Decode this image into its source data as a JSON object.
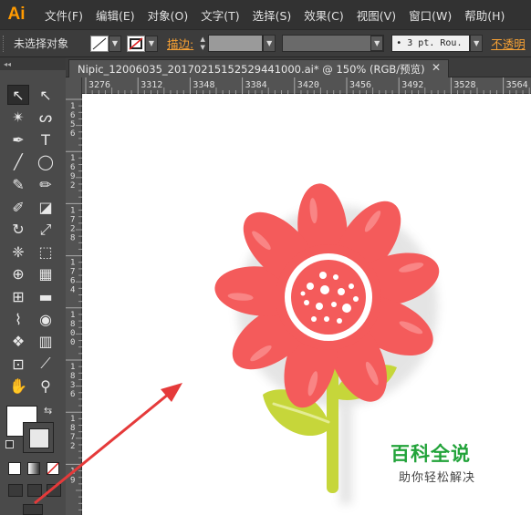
{
  "app": {
    "logo_text": "Ai"
  },
  "menu": {
    "items": [
      "文件(F)",
      "编辑(E)",
      "对象(O)",
      "文字(T)",
      "选择(S)",
      "效果(C)",
      "视图(V)",
      "窗口(W)",
      "帮助(H)"
    ]
  },
  "control_bar": {
    "selection_status": "未选择对象",
    "stroke_label": "描边:",
    "brush_value": "• 3 pt. Rou.",
    "opacity_label": "不透明"
  },
  "tools_panel": {
    "header_glyph": "◂◂",
    "tools": [
      {
        "name": "selection-tool",
        "glyph": "↖"
      },
      {
        "name": "direct-selection-tool",
        "glyph": "↖"
      },
      {
        "name": "magic-wand-tool",
        "glyph": "✴"
      },
      {
        "name": "lasso-tool",
        "glyph": "ᔕ"
      },
      {
        "name": "pen-tool",
        "glyph": "✒"
      },
      {
        "name": "type-tool",
        "glyph": "T"
      },
      {
        "name": "line-tool",
        "glyph": "╱"
      },
      {
        "name": "ellipse-tool",
        "glyph": "◯"
      },
      {
        "name": "paintbrush-tool",
        "glyph": "✎"
      },
      {
        "name": "pencil-tool",
        "glyph": "✏"
      },
      {
        "name": "blob-brush-tool",
        "glyph": "✐"
      },
      {
        "name": "eraser-tool",
        "glyph": "◪"
      },
      {
        "name": "rotate-tool",
        "glyph": "↻"
      },
      {
        "name": "scale-tool",
        "glyph": "⤢"
      },
      {
        "name": "warp-tool",
        "glyph": "❈"
      },
      {
        "name": "free-transform-tool",
        "glyph": "⬚"
      },
      {
        "name": "shape-builder-tool",
        "glyph": "⊕"
      },
      {
        "name": "perspective-grid-tool",
        "glyph": "▦"
      },
      {
        "name": "mesh-tool",
        "glyph": "⊞"
      },
      {
        "name": "gradient-tool",
        "glyph": "▬"
      },
      {
        "name": "eyedropper-tool",
        "glyph": "⌇"
      },
      {
        "name": "blend-tool",
        "glyph": "◉"
      },
      {
        "name": "symbol-sprayer-tool",
        "glyph": "❖"
      },
      {
        "name": "column-graph-tool",
        "glyph": "▥"
      },
      {
        "name": "artboard-tool",
        "glyph": "⊡"
      },
      {
        "name": "slice-tool",
        "glyph": "⟋"
      },
      {
        "name": "hand-tool",
        "glyph": "✋"
      },
      {
        "name": "zoom-tool",
        "glyph": "⚲"
      }
    ]
  },
  "document": {
    "tab_title": "Nipic_12006035_20170215152529441000.ai*  @  150% (RGB/预览)",
    "close_glyph": "✕"
  },
  "rulers": {
    "horizontal": [
      "3276",
      "3312",
      "3348",
      "3384",
      "3420",
      "3456",
      "3492",
      "3528",
      "3564"
    ],
    "vertical": [
      "1\n6\n5\n6",
      "1\n6\n9\n2",
      "1\n7\n2\n8",
      "1\n7\n6\n4",
      "1\n8\n0\n0",
      "1\n8\n3\n6",
      "1\n8\n7\n2",
      "1\n9"
    ]
  },
  "watermark": {
    "title": "百科全说",
    "subtitle": "助你轻松解决"
  },
  "colors": {
    "petal": "#f45b5b",
    "petal_highlight": "#f98585",
    "stem": "#c6d63a",
    "arrow": "#e53a3a",
    "watermark_green": "#22a33a"
  }
}
